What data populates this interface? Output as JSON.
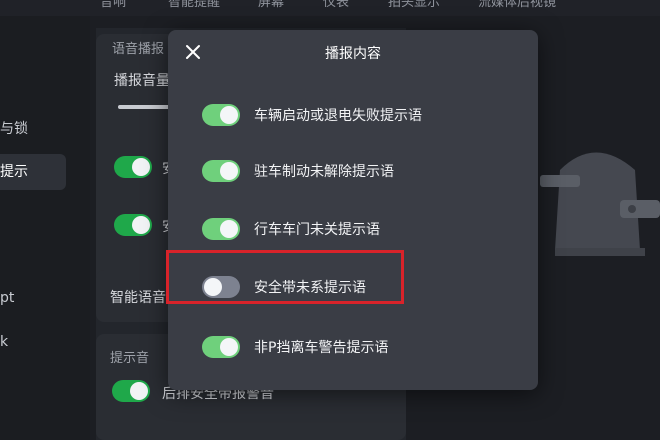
{
  "top_tabs": [
    "音响",
    "智能提醒",
    "屏幕",
    "仪表",
    "拍头显示",
    "流媒体后视镜"
  ],
  "left_nav": {
    "items": [
      {
        "label": "与锁",
        "active": false
      },
      {
        "label": "提示",
        "active": true
      },
      {
        "label": "pt",
        "active": false
      },
      {
        "label": "k",
        "active": false
      }
    ]
  },
  "background_panel": {
    "section_broadcast": "语音播报",
    "volume_label": "播报音量",
    "smart_voice_label": "智能语音",
    "prompt_section": "提示音",
    "rear_belt_label": "后排安全带报警音",
    "toggle_partial_labels": [
      "安",
      "安"
    ]
  },
  "modal": {
    "title": "播报内容",
    "close_icon": "close-icon",
    "items": [
      {
        "label": "车辆启动或退电失败提示语",
        "enabled": true
      },
      {
        "label": "驻车制动未解除提示语",
        "enabled": true
      },
      {
        "label": "行车车门未关提示语",
        "enabled": true
      },
      {
        "label": "安全带未系提示语",
        "enabled": false
      },
      {
        "label": "非P挡离车警告提示语",
        "enabled": true
      }
    ]
  },
  "colors": {
    "toggle_on_modal": "#6fd07c",
    "toggle_off_modal": "#7d8290",
    "toggle_on_bg": "#1fa84a",
    "highlight": "#d8232a",
    "modal_bg": "#3a3d45"
  }
}
